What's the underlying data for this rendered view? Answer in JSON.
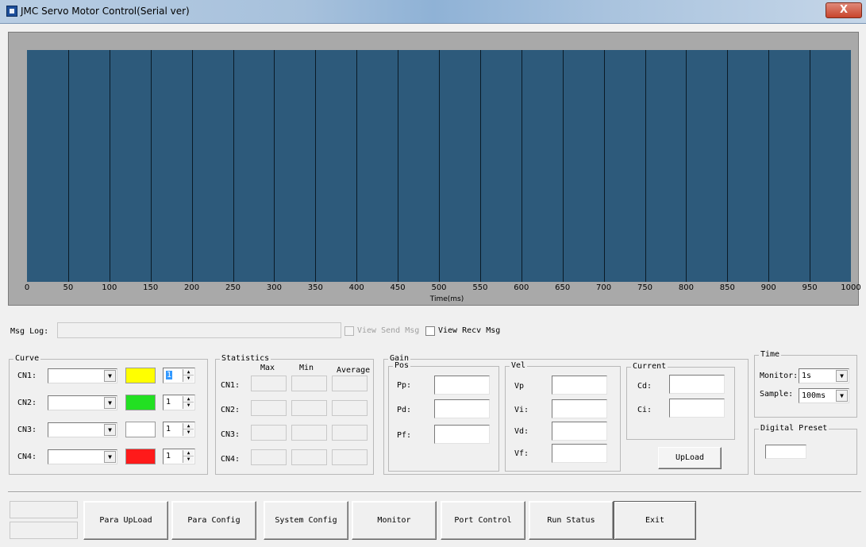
{
  "window": {
    "title": "JMC Servo Motor Control(Serial ver)",
    "close_glyph": "X"
  },
  "chart_data": {
    "type": "line",
    "x": [
      0,
      50,
      100,
      150,
      200,
      250,
      300,
      350,
      400,
      450,
      500,
      550,
      600,
      650,
      700,
      750,
      800,
      850,
      900,
      950,
      1000
    ],
    "xlabel": "Time(ms)",
    "xlim": [
      0,
      1000
    ],
    "ylabel": "",
    "series": [],
    "grid": "vertical",
    "background": "#2d5a7b"
  },
  "msglog": {
    "label": "Msg Log:",
    "value": "",
    "view_send_label": "View Send Msg",
    "view_recv_label": "View Recv Msg"
  },
  "curve": {
    "title": "Curve",
    "rows": [
      {
        "label": "CN1:",
        "select": "",
        "color": "#ffff00",
        "spin": "1"
      },
      {
        "label": "CN2:",
        "select": "",
        "color": "#22e022",
        "spin": "1"
      },
      {
        "label": "CN3:",
        "select": "",
        "color": "#ffffff",
        "spin": "1"
      },
      {
        "label": "CN4:",
        "select": "",
        "color": "#ff1a1a",
        "spin": "1"
      }
    ]
  },
  "statistics": {
    "title": "Statistics",
    "headers": [
      "Max",
      "Min",
      "Average"
    ],
    "rows": [
      "CN1:",
      "CN2:",
      "CN3:",
      "CN4:"
    ]
  },
  "gain": {
    "title": "Gain",
    "pos": {
      "title": "Pos",
      "labels": [
        "Pp:",
        "Pd:",
        "Pf:"
      ]
    },
    "vel": {
      "title": "Vel",
      "labels": [
        "Vp",
        "Vi:",
        "Vd:",
        "Vf:"
      ]
    },
    "current": {
      "title": "Current",
      "labels": [
        "Cd:",
        "Ci:"
      ]
    },
    "upload_label": "UpLoad"
  },
  "time": {
    "title": "Time",
    "monitor_label": "Monitor:",
    "monitor_value": "1s",
    "sample_label": "Sample:",
    "sample_value": "100ms"
  },
  "digital_preset": {
    "title": "Digital Preset",
    "value": ""
  },
  "toolbar": {
    "buttons": [
      "Para UpLoad",
      "Para Config",
      "System Config",
      "Monitor",
      "Port Control",
      "Run Status",
      "Exit"
    ]
  }
}
